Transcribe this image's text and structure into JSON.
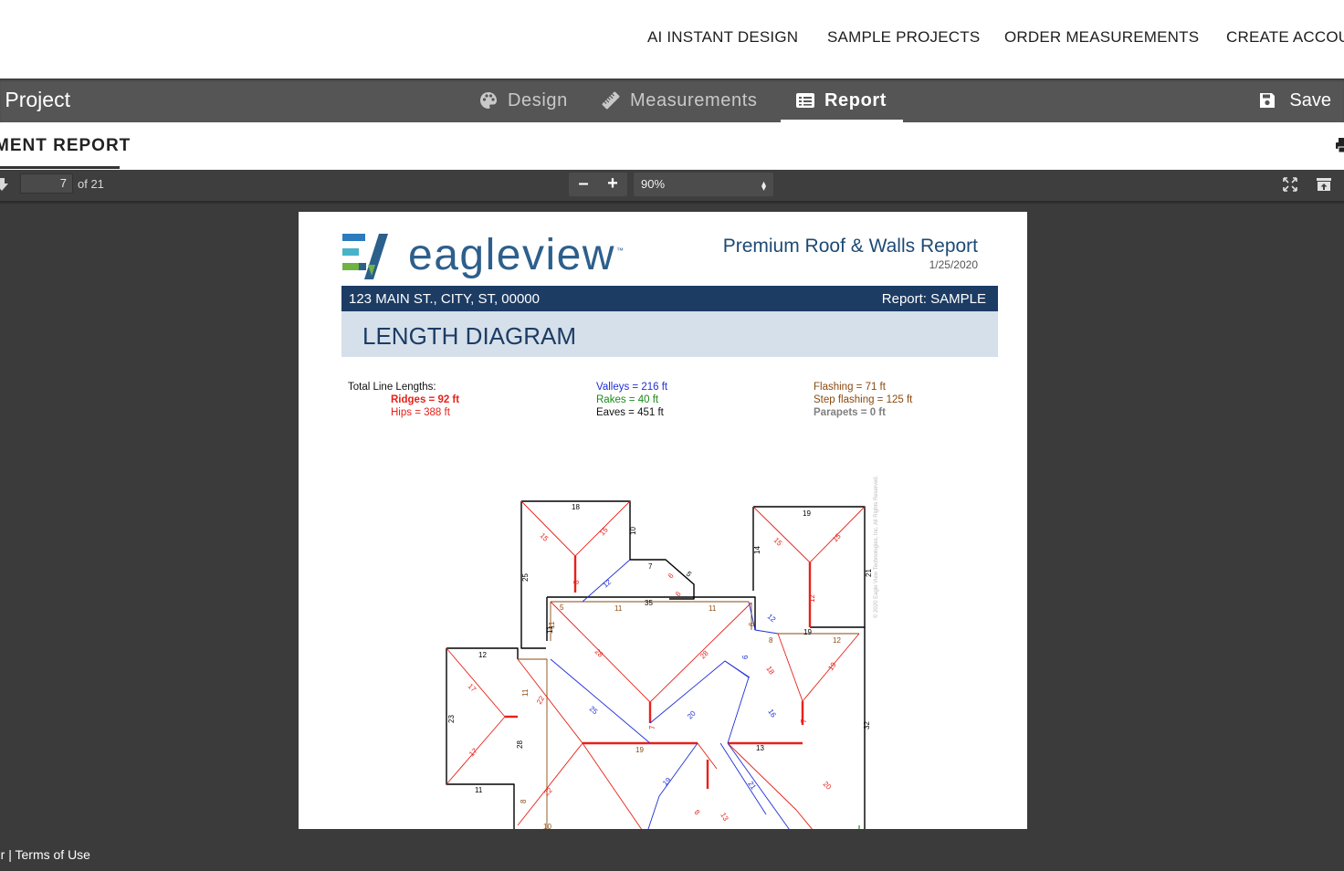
{
  "nav": {
    "items": [
      "AI INSTANT DESIGN",
      "SAMPLE PROJECTS",
      "ORDER MEASUREMENTS",
      "CREATE ACCOUNT"
    ]
  },
  "project": {
    "title": "Sample Project",
    "tabs": [
      {
        "label": "Design",
        "icon": "palette-icon"
      },
      {
        "label": "Measurements",
        "icon": "ruler-icon"
      },
      {
        "label": "Report",
        "icon": "list-icon",
        "active": true
      }
    ],
    "save_label": "Save"
  },
  "report_tab": {
    "label": "MEASUREMENT REPORT"
  },
  "pdf_toolbar": {
    "current_page": "7",
    "of_pages": "of 21",
    "zoom": "90%"
  },
  "document": {
    "logo": "eagleview",
    "logo_tm": "™",
    "title": "Premium Roof & Walls Report",
    "date": "1/25/2020",
    "address": "123 MAIN ST., CITY, ST, 00000",
    "report_id": "Report: SAMPLE",
    "section": "LENGTH DIAGRAM",
    "total_label": "Total Line Lengths:",
    "ridges": "Ridges = 92 ft",
    "hips": "Hips = 388 ft",
    "valleys": "Valleys = 216 ft",
    "rakes": "Rakes = 40 ft",
    "eaves": "Eaves = 451 ft",
    "flashing": "Flashing = 71 ft",
    "step_flashing": "Step flashing = 125 ft",
    "parapets": "Parapets = 0 ft",
    "copyright": "© 2020 Eagle View Technologies, Inc. All Rights Reserved.",
    "colors": {
      "ridge": "#e8211a",
      "hip": "#e8211a",
      "valley": "#1f2fd6",
      "rake": "#1a8a1a",
      "eave": "#000000",
      "flashing": "#8a4a10",
      "parapet": "#808080"
    }
  },
  "footer": {
    "links": "Disclaimer | Terms of Use"
  }
}
